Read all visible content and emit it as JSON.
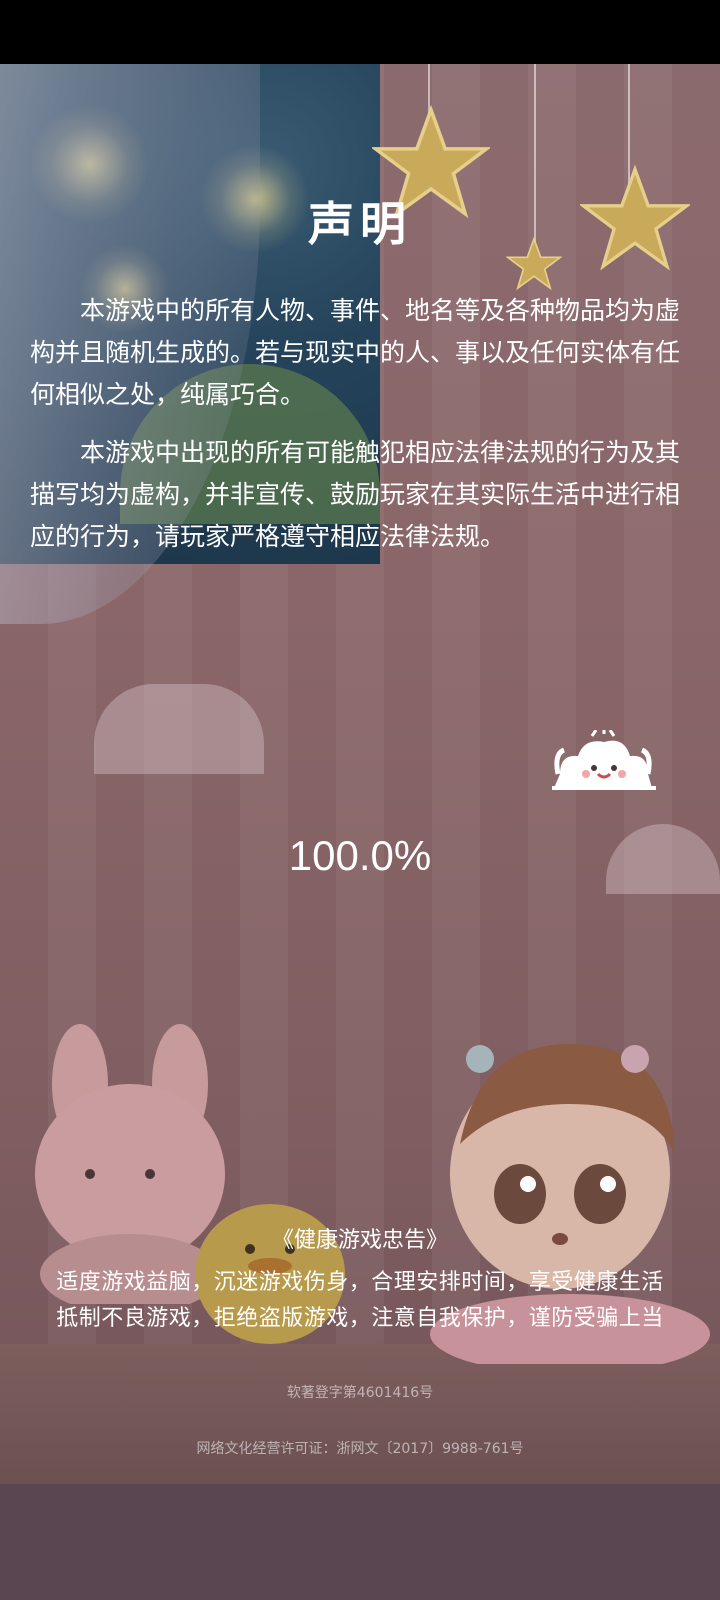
{
  "notice": {
    "title": "声明",
    "paragraph1": "本游戏中的所有人物、事件、地名等及各种物品均为虚构并且随机生成的。若与现实中的人、事以及任何实体有任何相似之处，纯属巧合。",
    "paragraph2": "本游戏中出现的所有可能触犯相应法律法规的行为及其描写均为虚构，并非宣传、鼓励玩家在其实际生活中进行相应的行为，请玩家严格遵守相应法律法规。"
  },
  "loading": {
    "progress_text": "100.0%",
    "progress": 1.0
  },
  "health_advice": {
    "title": "《健康游戏忠告》",
    "line1": "适度游戏益脑，沉迷游戏伤身，合理安排时间，享受健康生活",
    "line2": "抵制不良游戏，拒绝盗版游戏，注意自我保护，谨防受骗上当"
  },
  "registration": {
    "software_copyright": "软著登字第4601416号",
    "culture_license": "网络文化经营许可证：浙网文〔2017〕9988-761号"
  },
  "icons": [
    "cloud-mascot-icon",
    "star-icon"
  ],
  "colors": {
    "background": "#8a6668",
    "text": "#ffffff",
    "muted_text": "#c9b3b6"
  }
}
